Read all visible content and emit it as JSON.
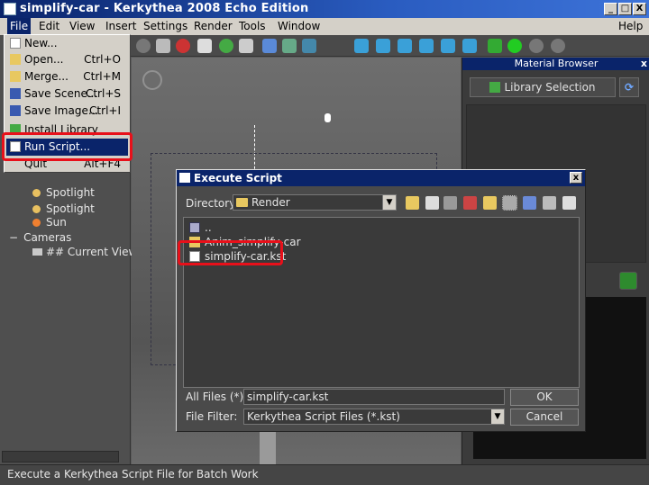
{
  "window": {
    "title": "simplify-car - Kerkythea 2008 Echo Edition",
    "minimize": "_",
    "maximize": "□",
    "close": "X"
  },
  "menubar": {
    "items": [
      "File",
      "Edit",
      "View",
      "Insert",
      "Settings",
      "Render",
      "Tools",
      "Window"
    ],
    "help": "Help"
  },
  "file_menu": {
    "items": [
      {
        "label": "New...",
        "shortcut": ""
      },
      {
        "label": "Open...",
        "shortcut": "Ctrl+O"
      },
      {
        "label": "Merge...",
        "shortcut": "Ctrl+M"
      },
      {
        "label": "Save Scene...",
        "shortcut": "Ctrl+S"
      },
      {
        "label": "Save Image...",
        "shortcut": "Ctrl+I"
      },
      {
        "label": "Install Library",
        "shortcut": ""
      },
      {
        "label": "Run Script...",
        "shortcut": ""
      },
      {
        "label": "Quit",
        "shortcut": "Alt+F4"
      }
    ]
  },
  "tree": {
    "lights": [
      "Spotlight",
      "Spotlight",
      "Spotlight",
      "Sun"
    ],
    "cameras_label": "Cameras",
    "expander": "−",
    "current_view": "## Current View"
  },
  "material_browser": {
    "title": "Material Browser",
    "close": "x",
    "library_button": "Library Selection",
    "refresh": "⟳"
  },
  "dialog": {
    "title": "Execute Script",
    "close": "x",
    "directory_label": "Directory:",
    "directory_value": "Render",
    "files": [
      "..",
      "Anim_simplify-car",
      "simplify-car.kst"
    ],
    "all_files_label": "All Files (*)",
    "filename_value": "simplify-car.kst",
    "ok_label": "OK",
    "filter_label": "File Filter:",
    "filter_value": "Kerkythea Script Files (*.kst)",
    "cancel_label": "Cancel"
  },
  "status_bar": {
    "text": "Execute a Kerkythea Script File for Batch Work"
  }
}
